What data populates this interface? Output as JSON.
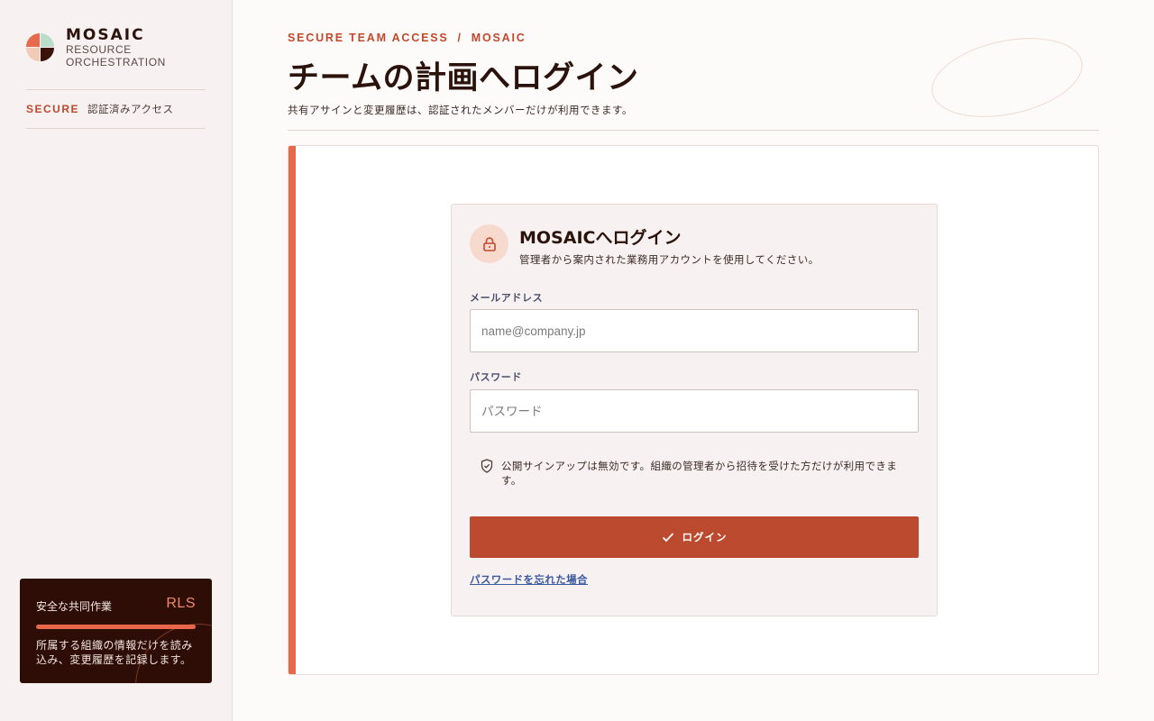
{
  "brand": {
    "name": "MOSAIC",
    "sub_line1": "RESOURCE",
    "sub_line2": "ORCHESTRATION",
    "colors": [
      "#e66a4c",
      "#bcdcca",
      "#f2cbb6",
      "#3a1208"
    ]
  },
  "sidebar": {
    "secure_tag": "SECURE",
    "secure_text": "認証済みアクセス",
    "rls_card": {
      "title": "安全な共同作業",
      "badge": "RLS",
      "progress": 1.0,
      "description": "所属する組織の情報だけを読み込み、変更履歴を記録します。"
    }
  },
  "header": {
    "breadcrumb_left": "SECURE TEAM ACCESS",
    "breadcrumb_sep": "/",
    "breadcrumb_right": "MOSAIC",
    "title": "チームの計画へログイン",
    "subtitle": "共有アサインと変更履歴は、認証されたメンバーだけが利用できます。"
  },
  "login": {
    "icon": "lock-icon",
    "title": "MOSAICへログイン",
    "subtitle": "管理者から案内された業務用アカウントを使用してください。",
    "email_label": "メールアドレス",
    "email_placeholder": "name@company.jp",
    "email_value": "",
    "password_label": "パスワード",
    "password_placeholder": "パスワード",
    "password_value": "",
    "notice_icon": "shield-check-icon",
    "notice": "公開サインアップは無効です。組織の管理者から招待を受けた方だけが利用できます。",
    "button_icon": "check-icon",
    "button_label": "ログイン",
    "forgot_link": "パスワードを忘れた場合"
  },
  "colors": {
    "accent": "#bc4a2e",
    "accent_light": "#e46a4c",
    "dark": "#2d0d05",
    "link": "#3d5a9e"
  }
}
